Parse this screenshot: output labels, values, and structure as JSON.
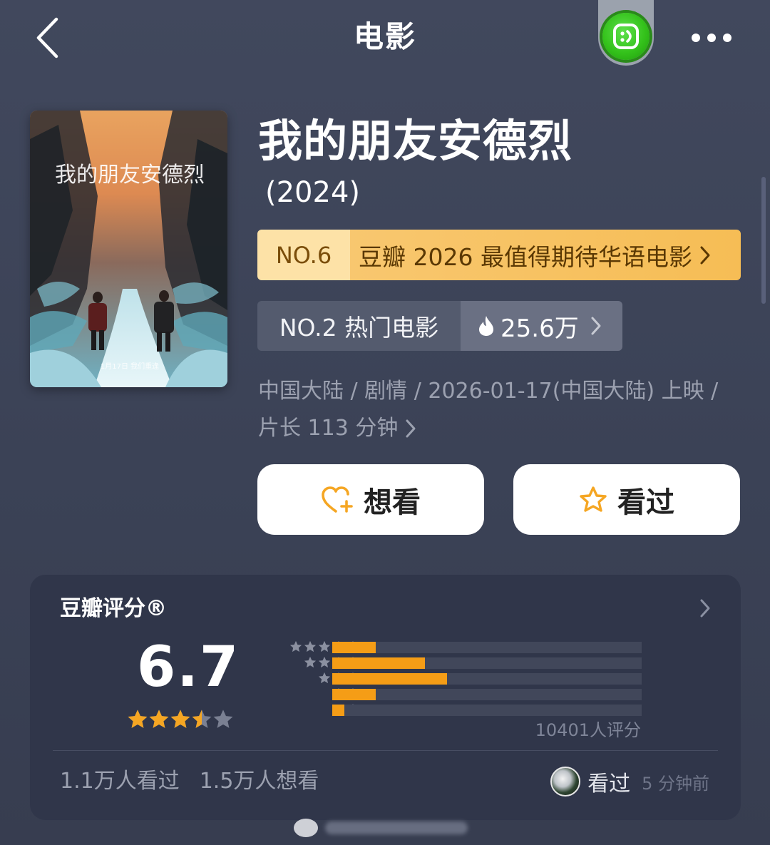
{
  "header": {
    "title": "电影",
    "back_icon": "chevron-left-icon",
    "mini_app_icon": "douban-smile-icon",
    "more_icon": "more-dots-icon"
  },
  "movie": {
    "title": "我的朋友安德烈",
    "year": "(2024)",
    "poster": {
      "title_art": "我的朋友安德烈",
      "release_note": "1月17日 我们重逢"
    }
  },
  "ranks": {
    "gold": {
      "number": "NO.6",
      "text": "豆瓣 2026 最值得期待华语电影",
      "color": "#f6bd55"
    },
    "hot": {
      "label": "NO.2 热门电影",
      "heat": "25.6万",
      "icon": "flame-icon"
    }
  },
  "meta": {
    "line1": "中国大陆 / 剧情 / 2026-01-17(中国大陆) 上映 /",
    "line2": "片长 113 分钟"
  },
  "actions": {
    "want": {
      "label": "想看",
      "icon": "heart-plus-icon",
      "icon_color": "#f5a623"
    },
    "seen": {
      "label": "看过",
      "icon": "star-outline-icon",
      "icon_color": "#f5a623"
    }
  },
  "rating": {
    "title": "豆瓣评分®",
    "score": "6.7",
    "stars_value": 3.5,
    "stars_max": 5,
    "distribution": [
      {
        "stars": 5,
        "fraction": 0.14
      },
      {
        "stars": 4,
        "fraction": 0.3
      },
      {
        "stars": 3,
        "fraction": 0.37
      },
      {
        "stars": 2,
        "fraction": 0.14
      },
      {
        "stars": 1,
        "fraction": 0.04
      }
    ],
    "count_text": "10401人评分",
    "bar_color": "#f59d16",
    "stats": {
      "seen": "1.1万人看过",
      "want": "1.5万人想看"
    },
    "friend": {
      "action": "看过",
      "time": "5 分钟前"
    }
  }
}
